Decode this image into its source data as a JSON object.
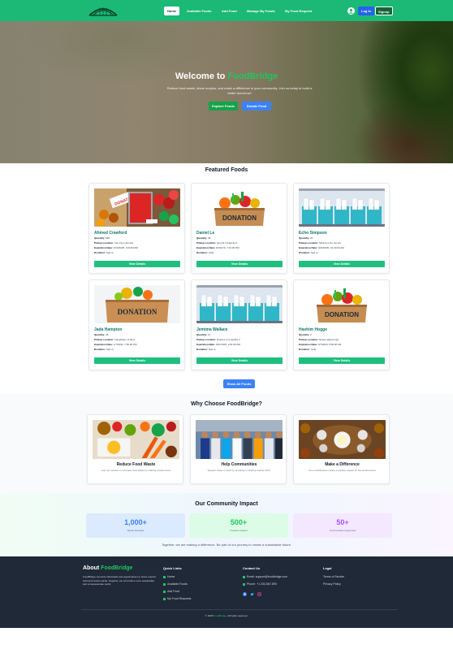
{
  "nav": {
    "links": [
      "Home",
      "Available Foods",
      "Add Food",
      "Manage My Foods",
      "My Food Request"
    ],
    "login": "Log In",
    "signup": "Signup"
  },
  "hero": {
    "title_prefix": "Welcome to ",
    "title_brand": "FoodBridge",
    "subtitle": "Reduce food waste, share surplus, and make a difference in your community. Join us today to build a better tomorrow!",
    "explore": "Explore Foods",
    "donate": "Donate Food"
  },
  "featured": {
    "title": "Featured Foods",
    "labels": {
      "quantity": "Quantity:",
      "pickup": "Pickup Location:",
      "expiry": "Expiration Date:",
      "status": "Donation:"
    },
    "items": [
      {
        "name": "Ahmed Crawford",
        "quantity": "698",
        "pickup": "Vel enim velit alis",
        "expiry": "3/13/2025, 9:03:00 AM",
        "status": "Sed ut",
        "image": "food-boxes-vegetables"
      },
      {
        "name": "Daniel Le",
        "quantity": "48",
        "pickup": "Qui elit occaecat O",
        "expiry": "6/4/1970, 7:10:00 PM",
        "status": "nulla",
        "image": "donation-box-fruits"
      },
      {
        "name": "Echo Simpson",
        "quantity": "20",
        "pickup": "Minima enim est ultr",
        "expiry": "4/20/2025, 10:29:00 AM",
        "status": "Sed ut",
        "image": "fridge-meal-bags"
      },
      {
        "name": "Jada Hampton",
        "quantity": "26",
        "pickup": "Voluptatem et illum",
        "expiry": "1/7/1992, 7:50:00 PM",
        "status": "Sed ut",
        "image": "donation-box-cardboard"
      },
      {
        "name": "Jemima Wallace",
        "quantity": "10",
        "pickup": "Dolores ut expedita d",
        "expiry": "3/21/1997, 2:51:00 AM",
        "status": "Sed ut",
        "image": "fridge-meal-bags"
      },
      {
        "name": "Hashim Hogge",
        "quantity": "2",
        "pickup": "Nesqu aliqua ingo",
        "expiry": "4/7/2023, 8:50:00 AM",
        "status": "nulla",
        "image": "donation-box-fruits"
      }
    ],
    "view_details": "View Details",
    "show_all": "Show All Foods"
  },
  "why": {
    "title": "Why Choose FoodBridge?",
    "cards": [
      {
        "title": "Reduce Food Waste",
        "desc": "Join our mission to minimize food waste by sharing surplus food.",
        "image": "produce-spread"
      },
      {
        "title": "Help Communities",
        "desc": "Support those in need by donating or sharing surplus food.",
        "image": "volunteer-group"
      },
      {
        "title": "Make a Difference",
        "desc": "Your contributions create a positive impact on the environment.",
        "image": "shared-meal-table"
      }
    ]
  },
  "impact": {
    "title": "Our Community Impact",
    "stats": [
      {
        "value": "1,000+",
        "label": "Meals Donated",
        "color": "#3b82f6"
      },
      {
        "value": "500+",
        "label": "Families Helped",
        "color": "#22c55e"
      },
      {
        "value": "50+",
        "label": "Communities Supported",
        "color": "#a855f7"
      }
    ],
    "footnote": "Together, we are making a difference. Be part of our journey to create a sustainable future."
  },
  "footer": {
    "about_prefix": "About ",
    "about_brand": "FoodBridge",
    "about_text": "FoodBridge connects individuals and organizations to share surplus food and reduce waste. Together, we can build a more sustainable and compassionate world.",
    "quick_links_title": "Quick Links",
    "quick_links": [
      "Home",
      "Available Foods",
      "Add Food",
      "My Food Requests"
    ],
    "contact_title": "Contact Us",
    "email": "Email: support@foodbridge.com",
    "phone": "Phone: +1 234-567-890",
    "legal_title": "Legal",
    "legal": [
      "Terms of Service",
      "Privacy Policy"
    ],
    "copy_prefix": "© 2025 ",
    "copy_brand": "FoodBridge",
    "copy_suffix": ". All rights reserved."
  }
}
